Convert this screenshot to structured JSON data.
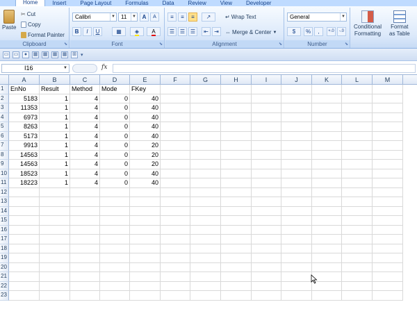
{
  "tabs": [
    "Home",
    "Insert",
    "Page Layout",
    "Formulas",
    "Data",
    "Review",
    "View",
    "Developer"
  ],
  "ribbon": {
    "clipboard": {
      "label": "Clipboard",
      "paste": "Paste",
      "cut": "Cut",
      "copy": "Copy",
      "format_painter": "Format Painter"
    },
    "font": {
      "label": "Font",
      "font_name": "Calibri",
      "font_size": "11",
      "bold": "B",
      "italic": "I",
      "underline": "U",
      "grow": "A",
      "shrink": "A",
      "color": "A"
    },
    "alignment": {
      "label": "Alignment",
      "wrap": "Wrap Text",
      "merge": "Merge & Center"
    },
    "number": {
      "label": "Number",
      "format": "General",
      "currency": "$",
      "percent": "%",
      "comma": ",",
      "inc": "+.0",
      "dec": "-.0"
    },
    "styles": {
      "conditional": "Conditional",
      "conditional2": "Formatting",
      "format_table": "Format",
      "format_table2": "as Table"
    }
  },
  "name_box": "I16",
  "fx": "fx",
  "columns": [
    "A",
    "B",
    "C",
    "D",
    "E",
    "F",
    "G",
    "H",
    "I",
    "J",
    "K",
    "L",
    "M"
  ],
  "rows": [
    "1",
    "2",
    "3",
    "4",
    "5",
    "6",
    "7",
    "8",
    "9",
    "10",
    "11",
    "12",
    "13",
    "14",
    "15",
    "16",
    "17",
    "18",
    "19",
    "20",
    "21",
    "22",
    "23"
  ],
  "table": {
    "headers": [
      "EnNo",
      "Result",
      "Method",
      "Mode",
      "FKey"
    ],
    "data": [
      [
        "5183",
        "1",
        "4",
        "0",
        "40"
      ],
      [
        "11353",
        "1",
        "4",
        "0",
        "40"
      ],
      [
        "6973",
        "1",
        "4",
        "0",
        "40"
      ],
      [
        "8263",
        "1",
        "4",
        "0",
        "40"
      ],
      [
        "5173",
        "1",
        "4",
        "0",
        "40"
      ],
      [
        "9913",
        "1",
        "4",
        "0",
        "20"
      ],
      [
        "14563",
        "1",
        "4",
        "0",
        "20"
      ],
      [
        "14563",
        "1",
        "4",
        "0",
        "20"
      ],
      [
        "18523",
        "1",
        "4",
        "0",
        "40"
      ],
      [
        "18223",
        "1",
        "4",
        "0",
        "40"
      ]
    ]
  },
  "colors": {
    "accent": "#bfdbff",
    "header_bg": "#e0e9f6",
    "grid": "#d9d9d9"
  }
}
